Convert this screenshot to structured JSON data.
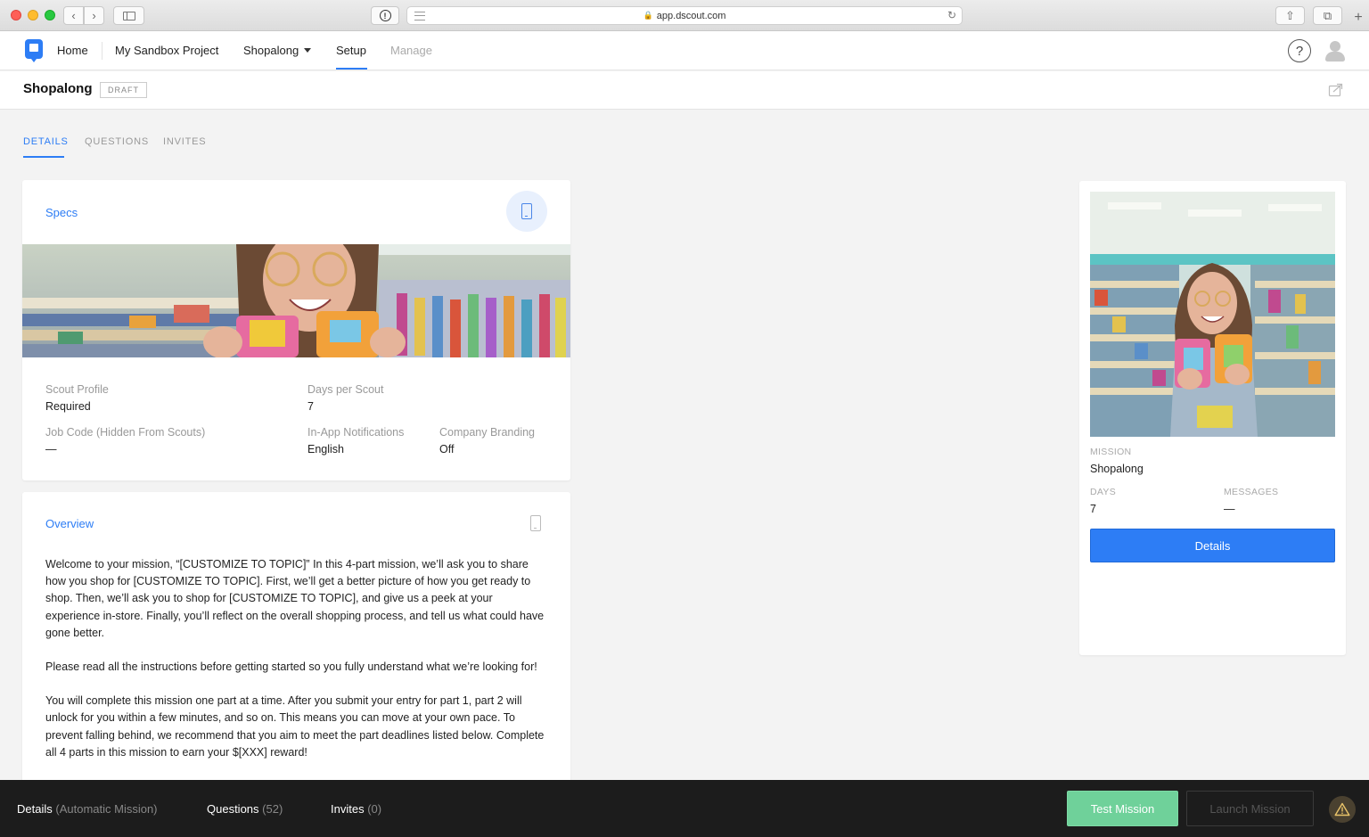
{
  "browser": {
    "url": "app.dscout.com"
  },
  "nav": {
    "home": "Home",
    "project": "My Sandbox Project",
    "mission_menu": "Shopalong",
    "setup": "Setup",
    "manage": "Manage",
    "help_glyph": "?"
  },
  "page": {
    "title": "Shopalong",
    "status": "DRAFT"
  },
  "tabs": [
    {
      "label": "DETAILS",
      "active": true
    },
    {
      "label": "QUESTIONS",
      "active": false
    },
    {
      "label": "INVITES",
      "active": false
    }
  ],
  "specs": {
    "title": "Specs",
    "scout_profile_label": "Scout Profile",
    "scout_profile_value": "Required",
    "days_label": "Days per Scout",
    "days_value": "7",
    "job_code_label": "Job Code (Hidden From Scouts)",
    "job_code_value": "—",
    "notifications_label": "In-App Notifications",
    "notifications_value": "English",
    "branding_label": "Company Branding",
    "branding_value": "Off"
  },
  "overview": {
    "title": "Overview",
    "paragraphs": [
      "Welcome to your mission, “[CUSTOMIZE TO TOPIC]” In this 4-part mission, we’ll ask you to share how you shop for [CUSTOMIZE TO TOPIC]. First, we’ll get a better picture of how you get ready to shop. Then, we’ll ask you to shop for [CUSTOMIZE TO TOPIC], and give us a peek at your experience in-store. Finally, you’ll reflect on the overall shopping process, and tell us what could have gone better.",
      "Please read all the instructions before getting started so you fully understand what we’re look­ing for!",
      "You will complete this mission one part at a time. After you submit your entry for part 1, part 2 will unlock for you within a few minutes, and so on. This means you can move at your own pace. To prevent falling behind, we recommend that you aim to meet the part deadlines listed below. Complete all 4 parts in this mission to earn your $[XXX] reward!"
    ]
  },
  "preview": {
    "mission_label": "MISSION",
    "mission_value": "Shopalong",
    "days_label": "DAYS",
    "days_value": "7",
    "messages_label": "MESSAGES",
    "messages_value": "—",
    "button": "Details"
  },
  "bottombar": {
    "details_label": "Details",
    "details_sub": "(Automatic Mission)",
    "questions_label": "Questions",
    "questions_count": "(52)",
    "invites_label": "Invites",
    "invites_count": "(0)",
    "test_button": "Test Mission",
    "launch_button": "Launch Mission"
  },
  "colors": {
    "accent": "#2d7df5",
    "success": "#6fd19a",
    "bottombar": "#1c1c1c"
  },
  "icons": [
    "back-icon",
    "forward-icon",
    "sidebar-icon",
    "password-icon",
    "reader-icon",
    "lock-icon",
    "reload-icon",
    "share-icon",
    "tabs-icon",
    "new-tab-icon",
    "dscout-logo-icon",
    "caret-down-icon",
    "help-icon",
    "avatar-icon",
    "export-icon",
    "phone-icon",
    "warning-icon"
  ]
}
